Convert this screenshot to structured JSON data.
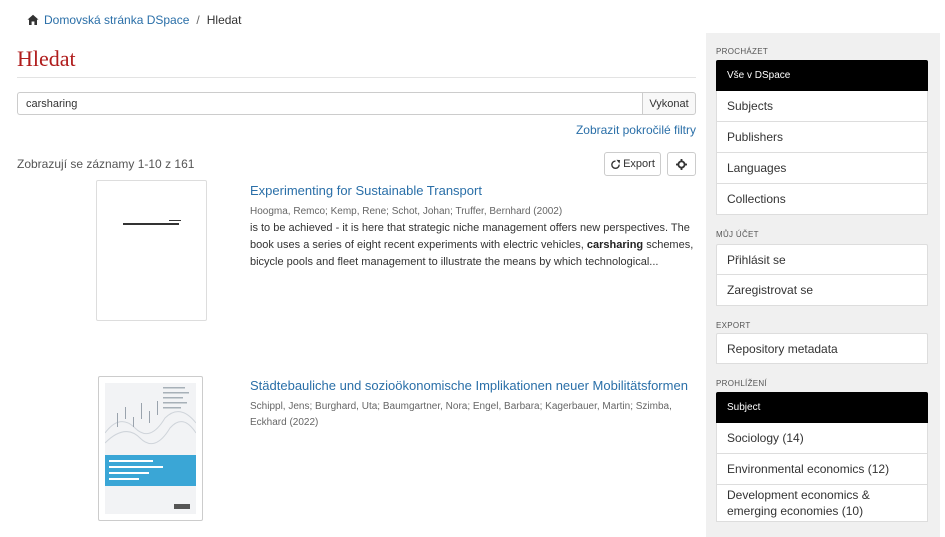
{
  "breadcrumb": {
    "home_label": "Domovská stránka DSpace",
    "separator": "/",
    "current": "Hledat"
  },
  "page_title": "Hledat",
  "search": {
    "value": "carsharing",
    "button_label": "Vykonat",
    "advanced_filters_label": "Zobrazit pokročilé filtry"
  },
  "results_info": "Zobrazují se záznamy 1-10 z 161",
  "toolbar": {
    "export_label": "Export"
  },
  "results": [
    {
      "title": "Experimenting for Sustainable Transport",
      "authors": "Hoogma, Remco; Kemp, Rene; Schot, Johan; Truffer, Bernhard (2002)",
      "abstract_before": "is to be achieved - it is here that strategic niche management offers new perspectives. The book uses a series of eight recent experiments with electric vehicles, ",
      "abstract_highlight": "carsharing",
      "abstract_after": " schemes, bicycle pools and fleet management to illustrate the means by which technological..."
    },
    {
      "title": "Städtebauliche und sozioökonomische Implikationen neuer Mobilitätsformen",
      "authors": "Schippl, Jens; Burghard, Uta; Baumgartner, Nora; Engel, Barbara; Kagerbauer, Martin; Szimba, Eckhard (2022)"
    }
  ],
  "sidebar": {
    "browse_heading": "PROCHÁZET",
    "browse_items": [
      "Vše v DSpace",
      "Subjects",
      "Publishers",
      "Languages",
      "Collections"
    ],
    "account_heading": "MŮJ ÚČET",
    "account_items": [
      "Přihlásit se",
      "Zaregistrovat se"
    ],
    "export_heading": "EXPORT",
    "export_items": [
      "Repository metadata"
    ],
    "discovery_heading": "PROHLÍŽENÍ",
    "discovery_items": [
      "Subject",
      "Sociology (14)",
      "Environmental economics (12)",
      "Development economics & emerging economies (10)"
    ]
  },
  "colors": {
    "link": "#2a6fa8",
    "title": "#b01c1c",
    "active_bg": "#000000",
    "sidebar_bg": "#f0f0f0"
  }
}
